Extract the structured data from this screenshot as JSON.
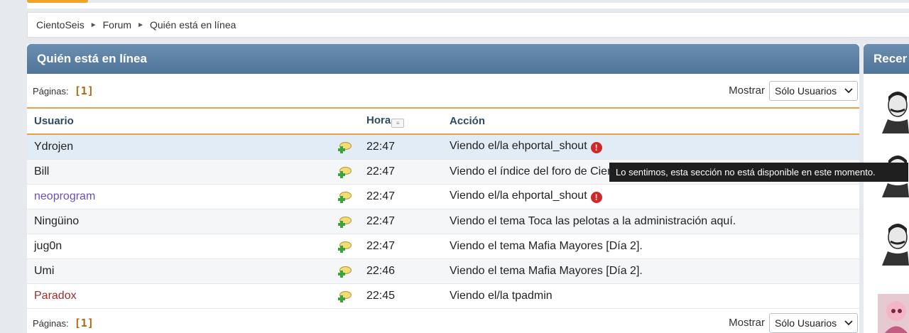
{
  "breadcrumb": {
    "items": [
      "CientoSeis",
      "Forum",
      "Quién está en línea"
    ],
    "separator": "►"
  },
  "panel": {
    "title": "Quién está en línea"
  },
  "pager": {
    "label": "Páginas:",
    "current": "[1]",
    "show_label": "Mostrar",
    "select_value": "Sólo Usuarios"
  },
  "table": {
    "headers": {
      "user": "Usuario",
      "time": "Hora",
      "action": "Acción"
    },
    "rows": [
      {
        "user": "Ydrojen",
        "user_color": "#222222",
        "time": "22:47",
        "action": "Viendo el/la ehportal_shout",
        "error": true
      },
      {
        "user": "Bill",
        "user_color": "#222222",
        "time": "22:47",
        "action": "Viendo el índice del foro de CientoSeis",
        "error": false
      },
      {
        "user": "neoprogram",
        "user_color": "#6a4fb8",
        "time": "22:47",
        "action": "Viendo el/la ehportal_shout",
        "error": true
      },
      {
        "user": "Ningüino",
        "user_color": "#222222",
        "time": "22:47",
        "action": "Viendo el tema Toca las pelotas a la administración aquí.",
        "error": false
      },
      {
        "user": "jug0n",
        "user_color": "#222222",
        "time": "22:47",
        "action": "Viendo el tema Mafia Mayores [Día 2].",
        "error": false
      },
      {
        "user": "Umi",
        "user_color": "#222222",
        "time": "22:46",
        "action": "Viendo el tema Mafia Mayores [Día 2].",
        "error": false
      },
      {
        "user": "Paradox",
        "user_color": "#a22c2c",
        "time": "22:45",
        "action": "Viendo el/la tpadmin",
        "error": false
      }
    ]
  },
  "tooltip": {
    "text": "Lo sentimos, esta sección no está disponible en este momento."
  },
  "side_panel": {
    "title": "Recer"
  },
  "colors": {
    "header_blue": "#5b80a2",
    "accent_orange": "#e2a14a",
    "pager_orange": "#b3670f",
    "error_red": "#cc2a2a"
  },
  "icons": {
    "pm": "send-pm-icon",
    "error": "error-icon",
    "sort": "sort-icon"
  }
}
